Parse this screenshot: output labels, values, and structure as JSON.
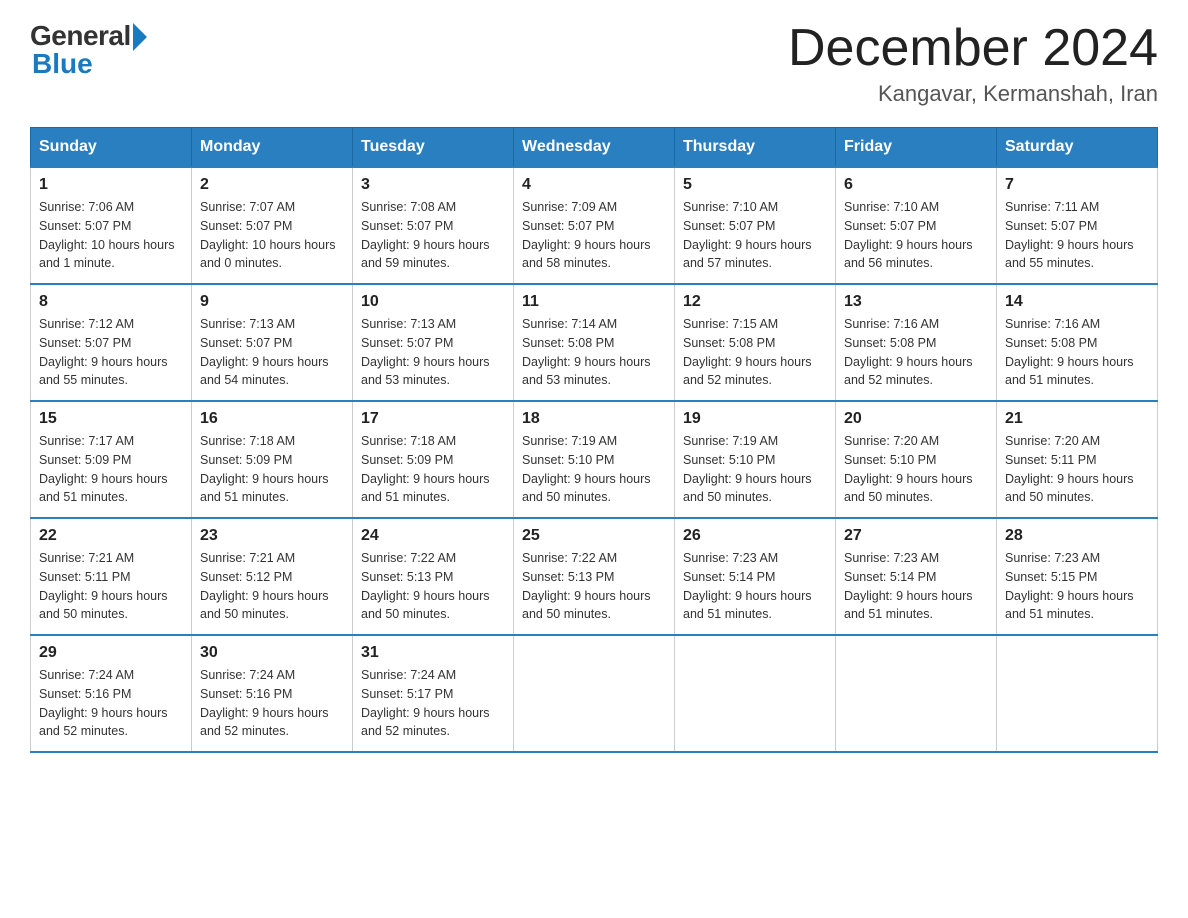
{
  "header": {
    "logo_general": "General",
    "logo_blue": "Blue",
    "month_title": "December 2024",
    "location": "Kangavar, Kermanshah, Iran"
  },
  "days_of_week": [
    "Sunday",
    "Monday",
    "Tuesday",
    "Wednesday",
    "Thursday",
    "Friday",
    "Saturday"
  ],
  "weeks": [
    [
      {
        "day": "1",
        "sunrise": "7:06 AM",
        "sunset": "5:07 PM",
        "daylight": "10 hours and 1 minute."
      },
      {
        "day": "2",
        "sunrise": "7:07 AM",
        "sunset": "5:07 PM",
        "daylight": "10 hours and 0 minutes."
      },
      {
        "day": "3",
        "sunrise": "7:08 AM",
        "sunset": "5:07 PM",
        "daylight": "9 hours and 59 minutes."
      },
      {
        "day": "4",
        "sunrise": "7:09 AM",
        "sunset": "5:07 PM",
        "daylight": "9 hours and 58 minutes."
      },
      {
        "day": "5",
        "sunrise": "7:10 AM",
        "sunset": "5:07 PM",
        "daylight": "9 hours and 57 minutes."
      },
      {
        "day": "6",
        "sunrise": "7:10 AM",
        "sunset": "5:07 PM",
        "daylight": "9 hours and 56 minutes."
      },
      {
        "day": "7",
        "sunrise": "7:11 AM",
        "sunset": "5:07 PM",
        "daylight": "9 hours and 55 minutes."
      }
    ],
    [
      {
        "day": "8",
        "sunrise": "7:12 AM",
        "sunset": "5:07 PM",
        "daylight": "9 hours and 55 minutes."
      },
      {
        "day": "9",
        "sunrise": "7:13 AM",
        "sunset": "5:07 PM",
        "daylight": "9 hours and 54 minutes."
      },
      {
        "day": "10",
        "sunrise": "7:13 AM",
        "sunset": "5:07 PM",
        "daylight": "9 hours and 53 minutes."
      },
      {
        "day": "11",
        "sunrise": "7:14 AM",
        "sunset": "5:08 PM",
        "daylight": "9 hours and 53 minutes."
      },
      {
        "day": "12",
        "sunrise": "7:15 AM",
        "sunset": "5:08 PM",
        "daylight": "9 hours and 52 minutes."
      },
      {
        "day": "13",
        "sunrise": "7:16 AM",
        "sunset": "5:08 PM",
        "daylight": "9 hours and 52 minutes."
      },
      {
        "day": "14",
        "sunrise": "7:16 AM",
        "sunset": "5:08 PM",
        "daylight": "9 hours and 51 minutes."
      }
    ],
    [
      {
        "day": "15",
        "sunrise": "7:17 AM",
        "sunset": "5:09 PM",
        "daylight": "9 hours and 51 minutes."
      },
      {
        "day": "16",
        "sunrise": "7:18 AM",
        "sunset": "5:09 PM",
        "daylight": "9 hours and 51 minutes."
      },
      {
        "day": "17",
        "sunrise": "7:18 AM",
        "sunset": "5:09 PM",
        "daylight": "9 hours and 51 minutes."
      },
      {
        "day": "18",
        "sunrise": "7:19 AM",
        "sunset": "5:10 PM",
        "daylight": "9 hours and 50 minutes."
      },
      {
        "day": "19",
        "sunrise": "7:19 AM",
        "sunset": "5:10 PM",
        "daylight": "9 hours and 50 minutes."
      },
      {
        "day": "20",
        "sunrise": "7:20 AM",
        "sunset": "5:10 PM",
        "daylight": "9 hours and 50 minutes."
      },
      {
        "day": "21",
        "sunrise": "7:20 AM",
        "sunset": "5:11 PM",
        "daylight": "9 hours and 50 minutes."
      }
    ],
    [
      {
        "day": "22",
        "sunrise": "7:21 AM",
        "sunset": "5:11 PM",
        "daylight": "9 hours and 50 minutes."
      },
      {
        "day": "23",
        "sunrise": "7:21 AM",
        "sunset": "5:12 PM",
        "daylight": "9 hours and 50 minutes."
      },
      {
        "day": "24",
        "sunrise": "7:22 AM",
        "sunset": "5:13 PM",
        "daylight": "9 hours and 50 minutes."
      },
      {
        "day": "25",
        "sunrise": "7:22 AM",
        "sunset": "5:13 PM",
        "daylight": "9 hours and 50 minutes."
      },
      {
        "day": "26",
        "sunrise": "7:23 AM",
        "sunset": "5:14 PM",
        "daylight": "9 hours and 51 minutes."
      },
      {
        "day": "27",
        "sunrise": "7:23 AM",
        "sunset": "5:14 PM",
        "daylight": "9 hours and 51 minutes."
      },
      {
        "day": "28",
        "sunrise": "7:23 AM",
        "sunset": "5:15 PM",
        "daylight": "9 hours and 51 minutes."
      }
    ],
    [
      {
        "day": "29",
        "sunrise": "7:24 AM",
        "sunset": "5:16 PM",
        "daylight": "9 hours and 52 minutes."
      },
      {
        "day": "30",
        "sunrise": "7:24 AM",
        "sunset": "5:16 PM",
        "daylight": "9 hours and 52 minutes."
      },
      {
        "day": "31",
        "sunrise": "7:24 AM",
        "sunset": "5:17 PM",
        "daylight": "9 hours and 52 minutes."
      },
      null,
      null,
      null,
      null
    ]
  ],
  "labels": {
    "sunrise": "Sunrise:",
    "sunset": "Sunset:",
    "daylight": "Daylight:"
  }
}
